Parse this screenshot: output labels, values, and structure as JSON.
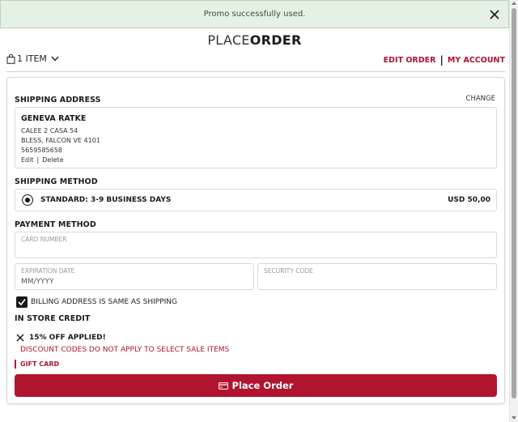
{
  "toast": {
    "message": "Promo successfully used."
  },
  "brand": {
    "part1": "PLACE",
    "part2": "ORDER"
  },
  "cart": {
    "item_count": "1 ITEM"
  },
  "header_links": {
    "edit_order": "EDIT ORDER",
    "separator": "|",
    "my_account": "MY ACCOUNT"
  },
  "shipping_address": {
    "title": "SHIPPING ADDRESS",
    "change_label": "CHANGE",
    "name": "GENEVA RATKE",
    "line1": "CALEE 2 CASA 54",
    "line2": "BLESS, FALCON VE 4101",
    "phone": "5659585658",
    "edit_label": "Edit",
    "action_separator": "|",
    "delete_label": "Delete"
  },
  "shipping_method": {
    "title": "SHIPPING METHOD",
    "option_label": "STANDARD: 3-9 BUSINESS DAYS",
    "option_price": "USD 50,00",
    "selected": true
  },
  "payment_method": {
    "title": "PAYMENT METHOD",
    "card_number_label": "CARD NUMBER",
    "expiration_label": "EXPIRATION DATE",
    "expiration_placeholder": "MM/YYYY",
    "security_code_label": "SECURITY CODE"
  },
  "billing": {
    "same_as_shipping_label": "BILLING ADDRESS IS SAME AS SHIPPING",
    "checked": true
  },
  "store_credit": {
    "title": "IN STORE CREDIT",
    "applied_label": "15% OFF APPLIED!",
    "note": "DISCOUNT CODES DO NOT APPLY TO SELECT SALE ITEMS",
    "gift_card_label": "GIFT CARD"
  },
  "place_order": {
    "label": "Place Order"
  },
  "colors": {
    "accent": "#b1142f",
    "link": "#b01430",
    "toast_bg": "#e5f1e4"
  },
  "icons": {
    "toast_close": "close-icon",
    "bag": "shopping-bag-icon",
    "chevron": "chevron-down-icon",
    "remove_discount": "close-icon",
    "place_order": "credit-card-icon"
  }
}
